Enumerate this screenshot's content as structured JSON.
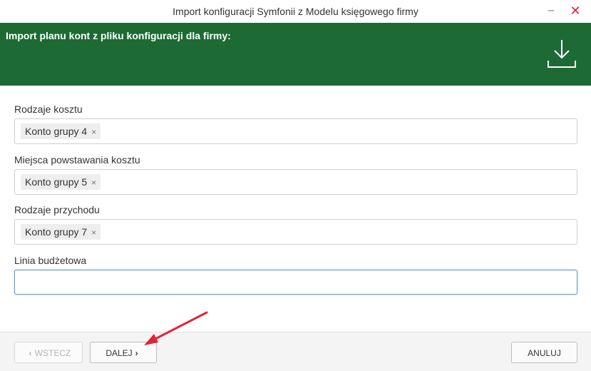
{
  "window": {
    "title": "Import konfiguracji Symfonii z Modelu księgowego firmy",
    "minimize_glyph": "–",
    "close_glyph": "✕"
  },
  "banner": {
    "title": "Import planu kont z pliku konfiguracji dla firmy:",
    "icon": "download-icon",
    "background": "#1d6a35"
  },
  "form": {
    "fields": [
      {
        "label": "Rodzaje kosztu",
        "tags": [
          "Konto grupy 4"
        ]
      },
      {
        "label": "Miejsca powstawania kosztu",
        "tags": [
          "Konto grupy 5"
        ]
      },
      {
        "label": "Rodzaje przychodu",
        "tags": [
          "Konto grupy 7"
        ]
      },
      {
        "label": "Linia budżetowa",
        "value": ""
      }
    ],
    "tag_remove_glyph": "×"
  },
  "footer": {
    "back_label": "WSTECZ",
    "next_label": "DALEJ",
    "cancel_label": "ANULUJ",
    "back_chevron": "‹",
    "next_chevron": "›"
  },
  "annotation": {
    "arrow_color": "#e0243a"
  }
}
